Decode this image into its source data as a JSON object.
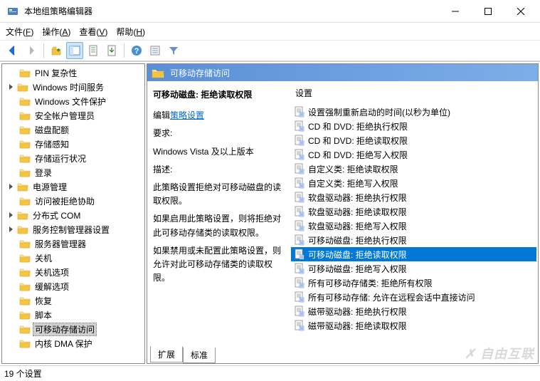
{
  "window": {
    "title": "本地组策略编辑器"
  },
  "menu": {
    "file": "文件(F)",
    "action": "操作(A)",
    "view": "查看(V)",
    "help": "帮助(H)"
  },
  "tree": {
    "items": [
      {
        "label": "PIN 复杂性",
        "children": false
      },
      {
        "label": "Windows 时间服务",
        "children": true
      },
      {
        "label": "Windows 文件保护",
        "children": false
      },
      {
        "label": "安全帐户管理员",
        "children": false
      },
      {
        "label": "磁盘配额",
        "children": false
      },
      {
        "label": "存储感知",
        "children": false
      },
      {
        "label": "存储运行状况",
        "children": false
      },
      {
        "label": "登录",
        "children": false
      },
      {
        "label": "电源管理",
        "children": true
      },
      {
        "label": "访问被拒绝协助",
        "children": false
      },
      {
        "label": "分布式 COM",
        "children": true
      },
      {
        "label": "服务控制管理器设置",
        "children": true
      },
      {
        "label": "服务器管理器",
        "children": false
      },
      {
        "label": "关机",
        "children": false
      },
      {
        "label": "关机选项",
        "children": false
      },
      {
        "label": "缓解选项",
        "children": false
      },
      {
        "label": "恢复",
        "children": false
      },
      {
        "label": "脚本",
        "children": false
      },
      {
        "label": "可移动存储访问",
        "children": false,
        "selected": true
      },
      {
        "label": "内核 DMA 保护",
        "children": false
      }
    ]
  },
  "rightPanel": {
    "headerTitle": "可移动存储访问",
    "detail": {
      "title": "可移动磁盘: 拒绝读取权限",
      "editPrefix": "编辑",
      "editLink": "策略设置",
      "reqLabel": "要求:",
      "reqValue": "Windows Vista 及以上版本",
      "descLabel": "描述:",
      "descValue": "此策略设置拒绝对可移动磁盘的读取权限。",
      "para1": "如果启用此策略设置，则将拒绝对此可移动存储类的读取权限。",
      "para2": "如果禁用或未配置此策略设置，则允许对此可移动存储类的读取权限。"
    },
    "columnHeader": "设置",
    "settings": [
      {
        "label": "设置强制重新启动的时间(以秒为单位)"
      },
      {
        "label": "CD 和 DVD: 拒绝执行权限"
      },
      {
        "label": "CD 和 DVD: 拒绝读取权限"
      },
      {
        "label": "CD 和 DVD: 拒绝写入权限"
      },
      {
        "label": "自定义类: 拒绝读取权限"
      },
      {
        "label": "自定义类: 拒绝写入权限"
      },
      {
        "label": "软盘驱动器: 拒绝执行权限"
      },
      {
        "label": "软盘驱动器: 拒绝读取权限"
      },
      {
        "label": "软盘驱动器: 拒绝写入权限"
      },
      {
        "label": "可移动磁盘: 拒绝执行权限"
      },
      {
        "label": "可移动磁盘: 拒绝读取权限",
        "selected": true
      },
      {
        "label": "可移动磁盘: 拒绝写入权限"
      },
      {
        "label": "所有可移动存储类: 拒绝所有权限"
      },
      {
        "label": "所有可移动存储: 允许在远程会话中直接访问"
      },
      {
        "label": "磁带驱动器: 拒绝执行权限"
      },
      {
        "label": "磁带驱动器: 拒绝读取权限"
      }
    ],
    "tabs": {
      "extended": "扩展",
      "standard": "标准"
    }
  },
  "statusbar": {
    "text": "19 个设置"
  },
  "watermark": "自由互联"
}
